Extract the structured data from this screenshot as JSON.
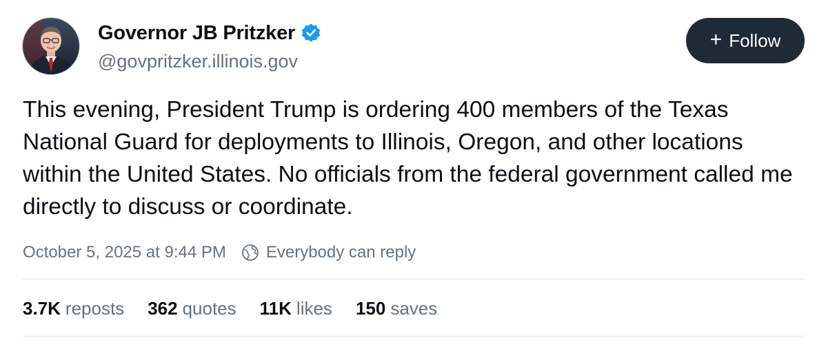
{
  "author": {
    "name": "Governor JB Pritzker",
    "handle": "@govpritzker.illinois.gov",
    "verified": true,
    "avatar_icon": "profile-photo"
  },
  "follow_button": {
    "icon": "plus-icon",
    "label": "Follow"
  },
  "post": {
    "text": "This evening, President Trump is ordering 400 members of the Texas National Guard for deployments to Illinois, Oregon, and other locations within the United States. No officials from the federal government called me directly to discuss or coordinate."
  },
  "meta": {
    "timestamp": "October 5, 2025 at 9:44 PM",
    "reply_icon": "globe-reply-icon",
    "reply_setting": "Everybody can reply"
  },
  "stats": [
    {
      "count": "3.7K",
      "label": "reposts"
    },
    {
      "count": "362",
      "label": "quotes"
    },
    {
      "count": "11K",
      "label": "likes"
    },
    {
      "count": "150",
      "label": "saves"
    }
  ],
  "colors": {
    "text_primary": "#0b0f14",
    "text_secondary": "#66727f",
    "verified_blue": "#1d9bf0",
    "follow_bg": "#1e2a35",
    "divider": "#dfe3e7"
  }
}
